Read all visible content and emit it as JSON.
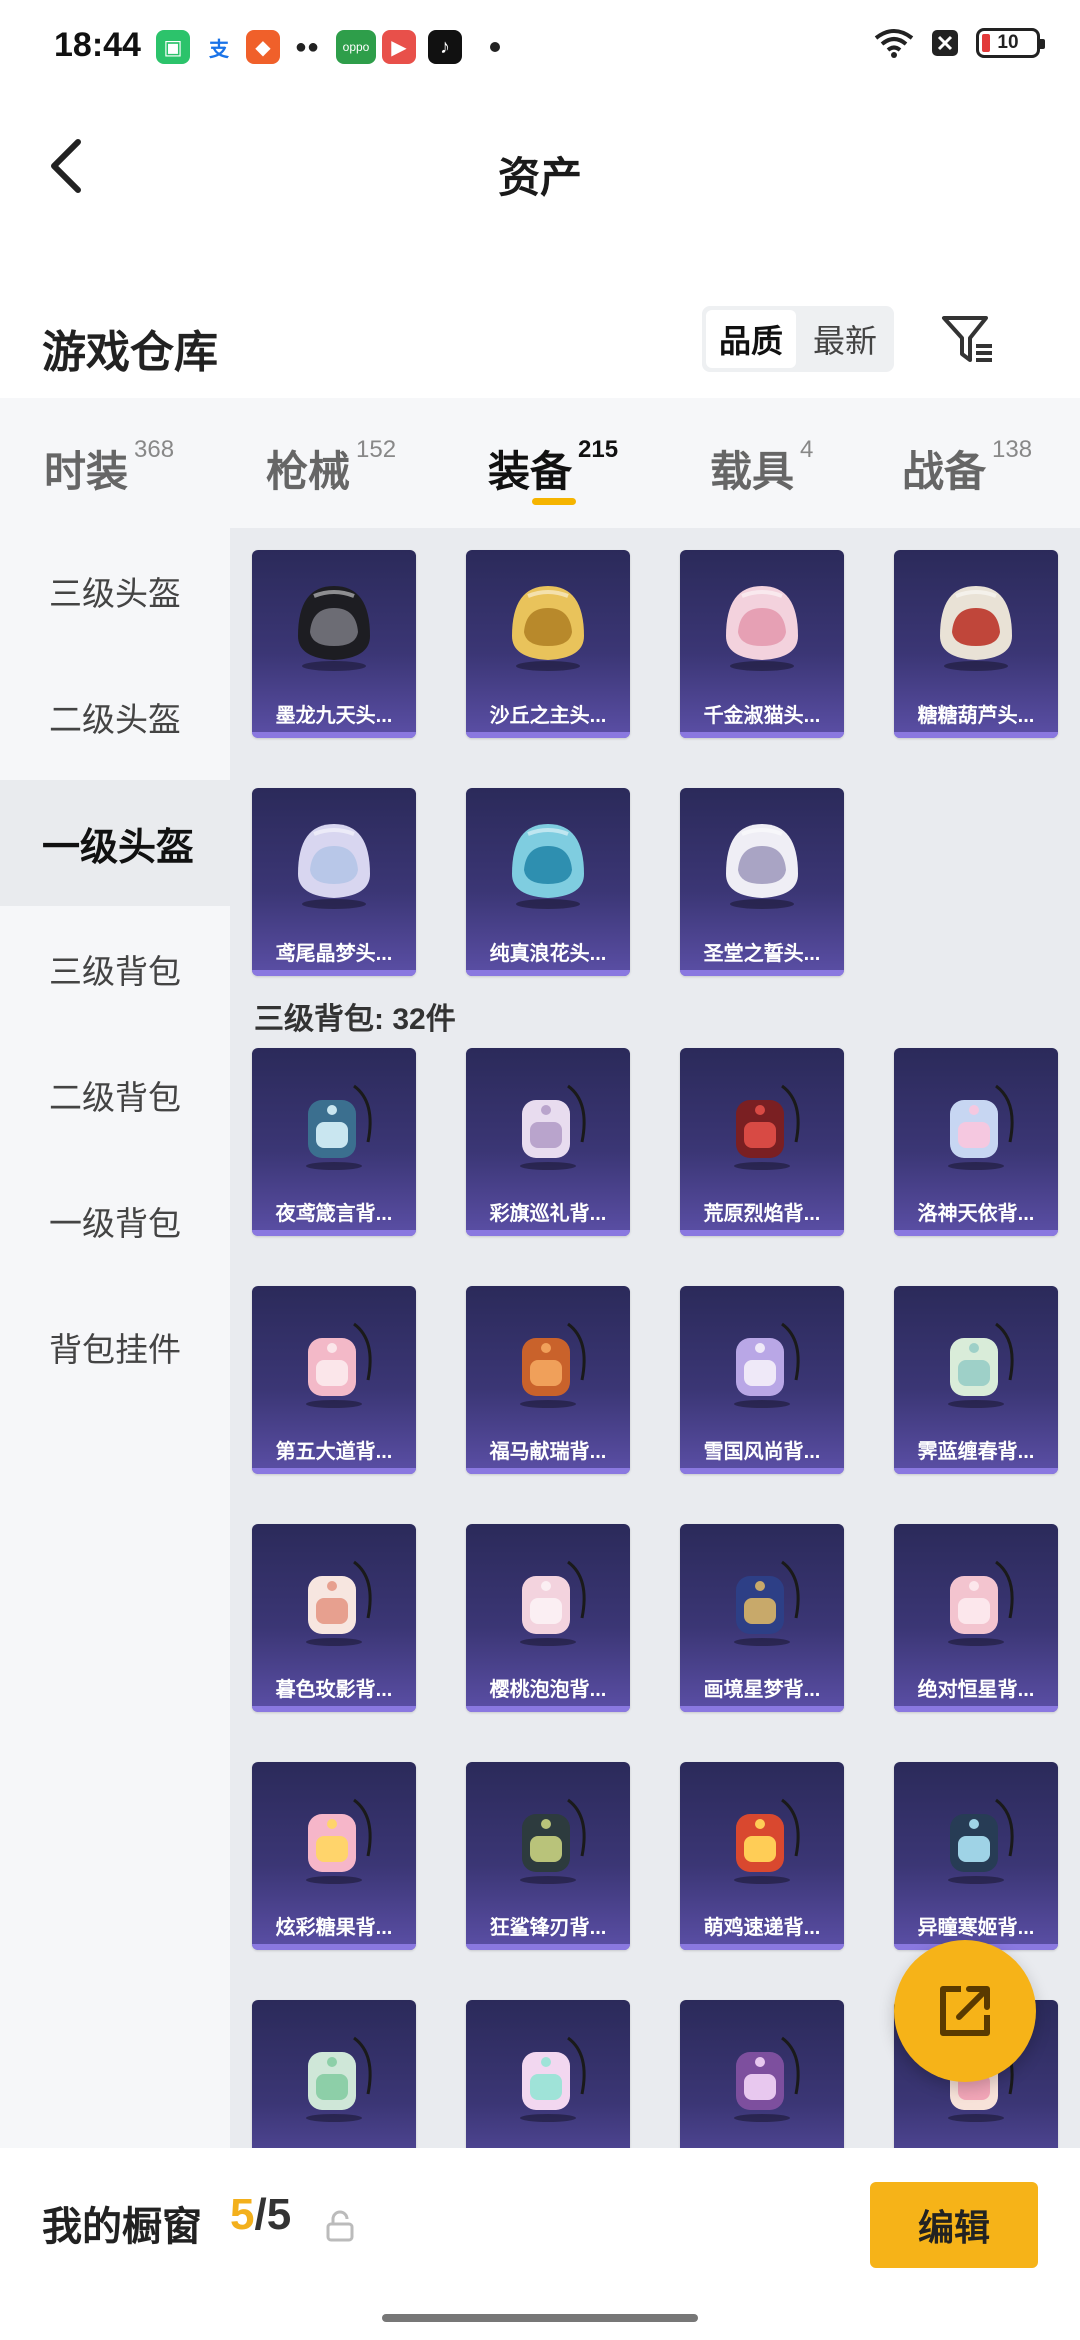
{
  "status_bar": {
    "time": "18:44",
    "battery": "10",
    "notification_icons": [
      "phone-manager-icon",
      "alipay-icon",
      "game-icon",
      "wechat-icon",
      "oppo-store-icon",
      "video-icon",
      "tiktok-icon"
    ],
    "right_icons": [
      "wifi-icon",
      "sim-off-icon",
      "battery-icon"
    ]
  },
  "header": {
    "title": "资产",
    "back_icon": "chevron-left-icon"
  },
  "section": {
    "title": "游戏仓库",
    "sort_options": [
      "品质",
      "最新"
    ],
    "active_sort": "品质",
    "filter_icon": "filter-icon"
  },
  "tabs": [
    {
      "label": "时装",
      "count": "368"
    },
    {
      "label": "枪械",
      "count": "152"
    },
    {
      "label": "装备",
      "count": "215",
      "active": true
    },
    {
      "label": "载具",
      "count": "4"
    },
    {
      "label": "战备",
      "count": "138"
    }
  ],
  "sidebar": {
    "items": [
      "三级头盔",
      "二级头盔",
      "一级头盔",
      "三级背包",
      "二级背包",
      "一级背包",
      "背包挂件"
    ],
    "active": "一级头盔"
  },
  "grid": {
    "helmets": [
      "墨龙九天头...",
      "沙丘之主头...",
      "千金淑猫头...",
      "糖糖葫芦头...",
      "鸢尾晶梦头...",
      "纯真浪花头...",
      "圣堂之誓头..."
    ],
    "backpack_heading": "三级背包: 32件",
    "backpacks": [
      "夜鸢箴言背...",
      "彩旗巡礼背...",
      "荒原烈焰背...",
      "洛神天依背...",
      "第五大道背...",
      "福马献瑞背...",
      "雪国风尚背...",
      "霁蓝缠春背...",
      "暮色玫影背...",
      "樱桃泡泡背...",
      "画境星梦背...",
      "绝对恒星背...",
      "炫彩糖果背...",
      "狂鲨锋刃背...",
      "萌鸡速递背...",
      "异瞳寒姬背...",
      "",
      "",
      "",
      ""
    ]
  },
  "colors": {
    "accent": "#f6b318",
    "card_bg": "#3b3675"
  },
  "bottom_bar": {
    "title": "我的橱窗",
    "count_current": "5",
    "count_total": "/5",
    "lock_icon": "lock-icon",
    "edit_label": "编辑"
  },
  "fab": {
    "icon": "share-external-icon"
  }
}
